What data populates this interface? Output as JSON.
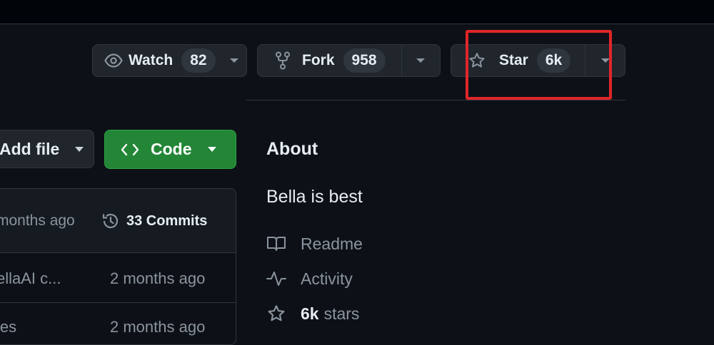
{
  "watch": {
    "label": "Watch",
    "count": "82"
  },
  "fork": {
    "label": "Fork",
    "count": "958"
  },
  "star": {
    "label": "Star",
    "count": "6k"
  },
  "add_file": {
    "label": "Add file"
  },
  "code": {
    "label": "Code"
  },
  "file_list": {
    "header": {
      "age": "months ago",
      "commits": "33 Commits"
    },
    "rows": [
      {
        "name": "ellaAI c...",
        "age": "2 months ago"
      },
      {
        "name": "les",
        "age": "2 months ago"
      }
    ]
  },
  "about": {
    "title": "About",
    "description": "Bella is best",
    "readme": "Readme",
    "activity": "Activity",
    "stars_count": "6k",
    "stars_label": "stars"
  },
  "colors": {
    "background": "#0d1117",
    "button": "#21262d",
    "border": "#30363d",
    "code_button": "#238636",
    "highlight": "#e0262a",
    "muted_text": "#8b949e"
  },
  "icons": [
    "eye-icon",
    "fork-icon",
    "star-icon",
    "code-brackets-icon",
    "history-icon",
    "book-icon",
    "pulse-icon"
  ]
}
